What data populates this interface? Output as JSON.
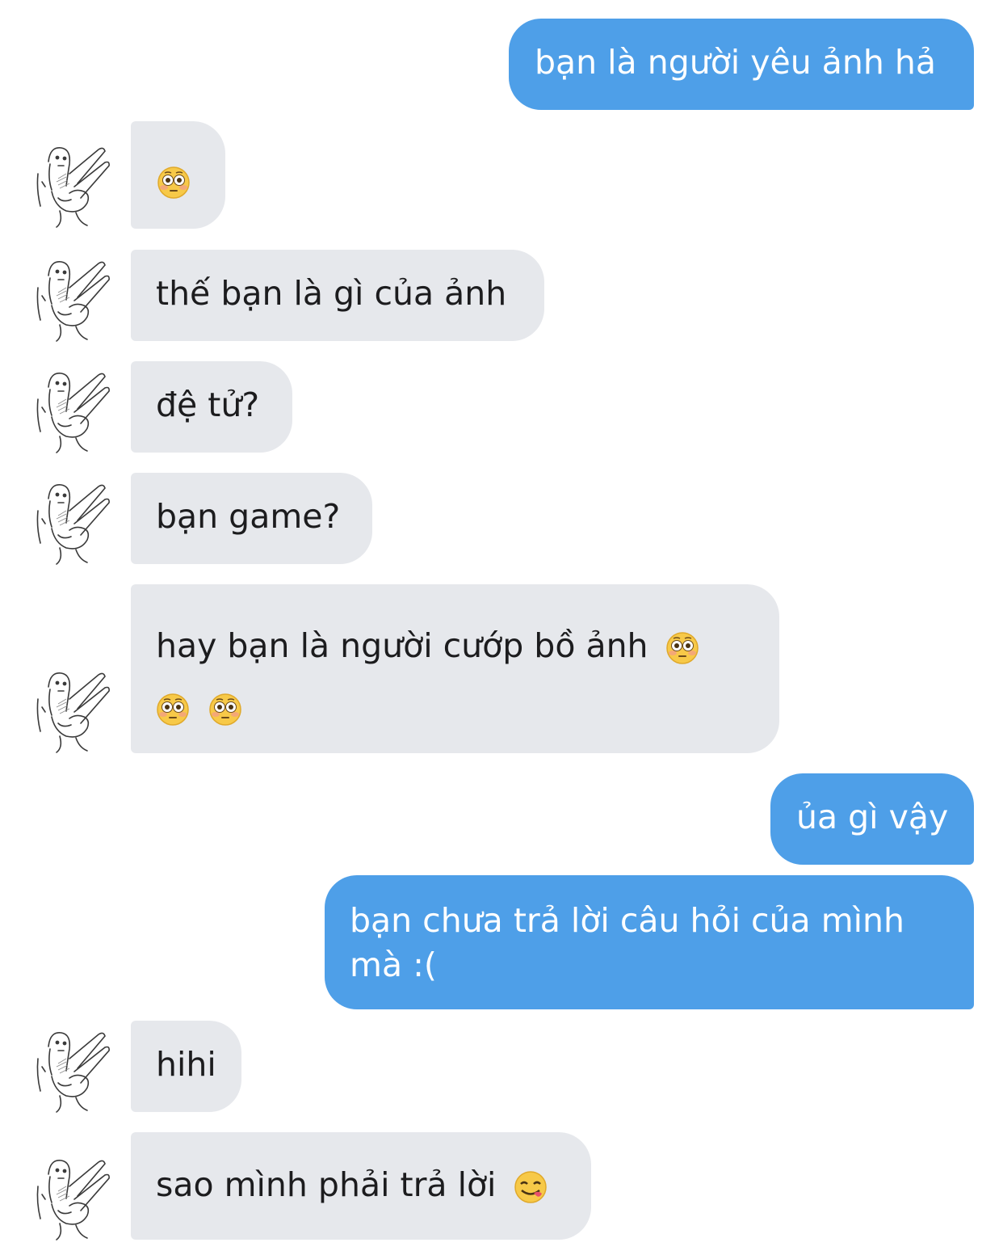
{
  "colors": {
    "sent_bubble": "#4e9fe8",
    "received_bubble": "#e6e8ec",
    "sent_text": "#ffffff",
    "received_text": "#1c1c1e"
  },
  "avatar_icon": "hand-drawn-peace-sign-avatar-icon",
  "messages": [
    {
      "direction": "sent",
      "text": "bạn là người yêu ảnh hả"
    },
    {
      "direction": "received",
      "text": "",
      "emojis": [
        "flushed-face"
      ]
    },
    {
      "direction": "received",
      "text": "thế bạn là gì của ảnh"
    },
    {
      "direction": "received",
      "text": "đệ tử?"
    },
    {
      "direction": "received",
      "text": "bạn game?"
    },
    {
      "direction": "received",
      "text": "hay bạn là người cướp bồ ảnh",
      "emojis": [
        "flushed-face",
        "flushed-face",
        "flushed-face"
      ]
    },
    {
      "direction": "sent",
      "text": "ủa gì vậy"
    },
    {
      "direction": "sent",
      "text": "bạn chưa trả lời câu hỏi của mình mà :("
    },
    {
      "direction": "received",
      "text": "hihi"
    },
    {
      "direction": "received",
      "text": "sao mình phải trả lời",
      "emojis": [
        "face-savoring-food"
      ]
    }
  ]
}
